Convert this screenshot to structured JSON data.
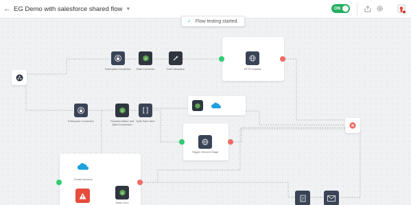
{
  "header": {
    "flow_title": "EG Demo with salesforce shared flow",
    "toggle_label": "ON"
  },
  "toast": {
    "message": "Flow testing started."
  },
  "nodes": {
    "enterprise_connector_1": "Enterprise Connector",
    "data_convertor": "Data Convertor",
    "salt_calculator": "Salt Calculator",
    "http_request": "HTTP request",
    "enterprise_connector_2": "Enterprise Connector",
    "transformation_split": "Transformation and Split Conversion",
    "split_each_item": "Split Each Item",
    "trigger_second_stage": "Trigger Second Stage",
    "create_account": "Create Account",
    "data_conv_bottom": "Data Conv"
  },
  "colors": {
    "accent_green": "#2ecc71",
    "error_red": "#e74c3c",
    "node_dark": "#2f3640"
  },
  "icons": {
    "start": "share-icon",
    "lock": "lock-icon",
    "code": "code-icon",
    "calculator": "wand-icon",
    "globe": "globe-icon",
    "salesforce": "salesforce-cloud-icon",
    "error": "error-icon",
    "mail": "mail-icon"
  }
}
